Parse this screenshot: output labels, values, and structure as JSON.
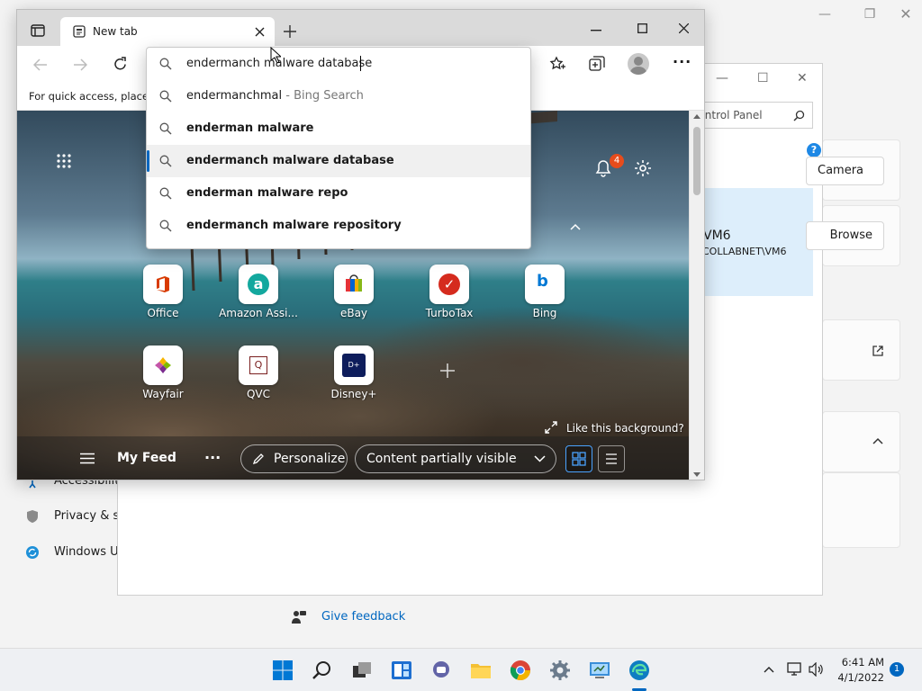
{
  "settings": {
    "left_items": [
      "Accessibility",
      "Privacy & security",
      "Windows Update"
    ],
    "camera_label": "Camera",
    "browse_label": "Browse files",
    "feedback_label": "Give feedback"
  },
  "control_panel": {
    "search_placeholder": "Search Control Panel",
    "account_name": "VM6",
    "account_domain": "COLLABNET\\VM6"
  },
  "browser": {
    "tab_title": "New tab",
    "favorites_hint": "For quick access, place your favorites here on the favorites bar.",
    "address_value": "endermanch malware database",
    "suggestions": [
      {
        "text": "endermanchmal",
        "suffix": " - Bing Search",
        "bold": false,
        "selected": false
      },
      {
        "text": "enderman malware",
        "suffix": "",
        "bold": true,
        "selected": false
      },
      {
        "text": "endermanch malware database",
        "suffix": "",
        "bold": true,
        "selected": true
      },
      {
        "text": "enderman malware repo",
        "suffix": "",
        "bold": true,
        "selected": false
      },
      {
        "text": "endermanch malware repository",
        "suffix": "",
        "bold": true,
        "selected": false
      }
    ],
    "notification_count": "4",
    "tiles": [
      {
        "label": "Office",
        "icon": "office-icon"
      },
      {
        "label": "Amazon Assi...",
        "icon": "amazon-icon"
      },
      {
        "label": "eBay",
        "icon": "ebay-icon"
      },
      {
        "label": "TurboTax",
        "icon": "turbotax-icon"
      },
      {
        "label": "Bing",
        "icon": "bing-icon"
      },
      {
        "label": "Wayfair",
        "icon": "wayfair-icon"
      },
      {
        "label": "QVC",
        "icon": "qvc-icon"
      },
      {
        "label": "Disney+",
        "icon": "disney-icon"
      }
    ],
    "like_background": "Like this background?",
    "feed": {
      "my_feed": "My Feed",
      "more": "···",
      "personalize": "Personalize",
      "visibility": "Content partially visible"
    }
  },
  "taskbar": {
    "time": "6:41 AM",
    "date": "4/1/2022",
    "notification_badge": "1"
  },
  "colors": {
    "accent": "#0067c0",
    "badge": "#e74c1c",
    "taskbar": "#eef0f3"
  }
}
